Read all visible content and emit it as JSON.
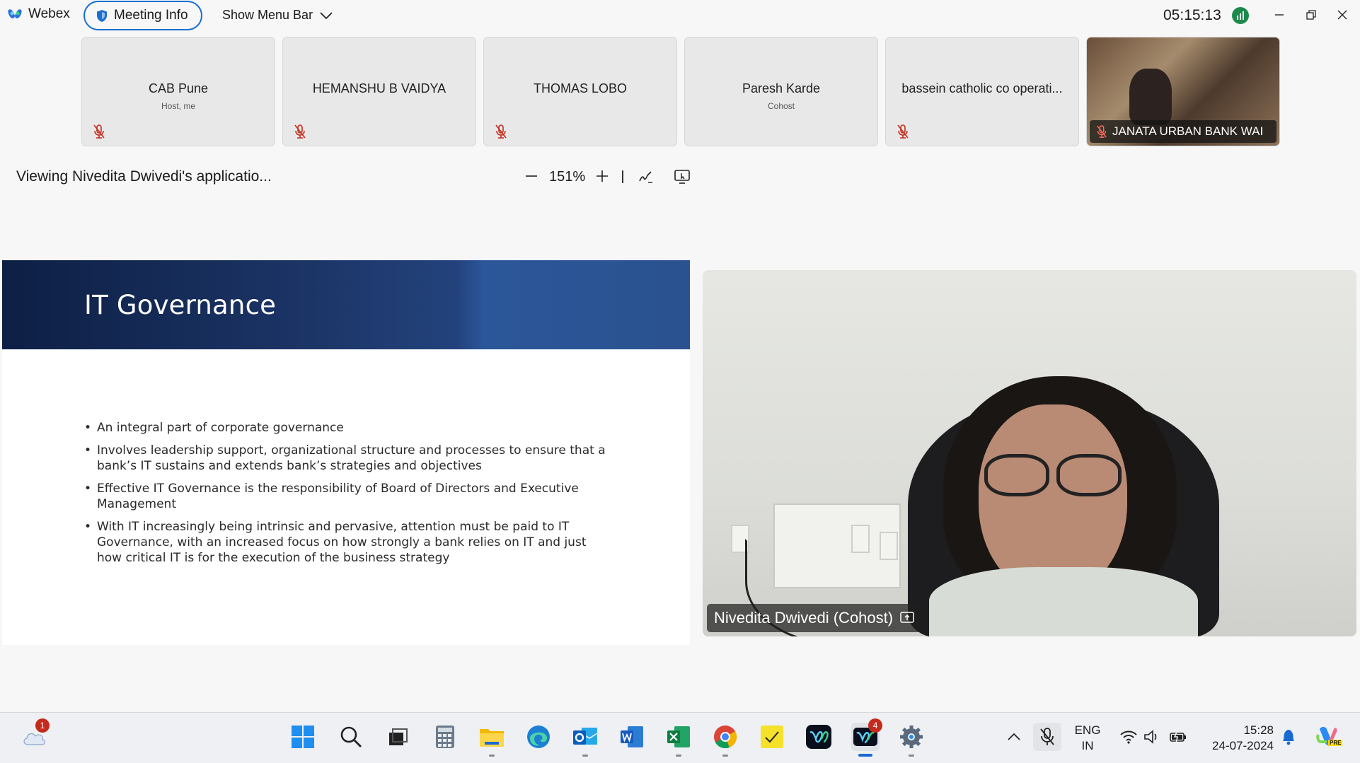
{
  "titlebar": {
    "app_name": "Webex",
    "meeting_info_label": "Meeting Info",
    "menu_bar_label": "Show Menu Bar",
    "clock": "05:15:13"
  },
  "participants": [
    {
      "name": "CAB Pune",
      "role": "Host, me",
      "muted": true
    },
    {
      "name": "HEMANSHU B VAIDYA",
      "role": "",
      "muted": true
    },
    {
      "name": "THOMAS LOBO",
      "role": "",
      "muted": true
    },
    {
      "name": "Paresh Karde",
      "role": "Cohost",
      "muted": false
    },
    {
      "name": "bassein catholic co operati...",
      "role": "",
      "muted": true
    },
    {
      "name": "JANATA URBAN BANK WAI",
      "role": "",
      "muted": true,
      "video": true
    }
  ],
  "share_toolbar": {
    "viewing_text": "Viewing Nivedita Dwivedi's applicatio...",
    "zoom_level": "151%"
  },
  "slide": {
    "title": "IT Governance",
    "bullets": [
      "An integral part of corporate governance",
      "Involves leadership support, organizational structure and processes to ensure that a bank’s IT sustains and extends bank’s strategies and objectives",
      "Effective IT Governance is the responsibility of Board of Directors and Executive Management",
      "With IT increasingly being intrinsic and pervasive, attention must be paid to IT Governance, with an increased focus on how strongly a bank relies on IT and just how critical IT is for the execution of the business strategy"
    ]
  },
  "speaker": {
    "label": "Nivedita Dwivedi (Cohost)"
  },
  "taskbar": {
    "weather_badge": "1",
    "webex_badge": "4",
    "language_line1": "ENG",
    "language_line2": "IN",
    "time": "15:28",
    "date": "24-07-2024",
    "copilot_tag": "PRE"
  },
  "colors": {
    "accent": "#1b6fd1",
    "slide_header_dark": "#0d1f44",
    "slide_header_light": "#2b5699",
    "muted_red": "#c42b1c"
  }
}
